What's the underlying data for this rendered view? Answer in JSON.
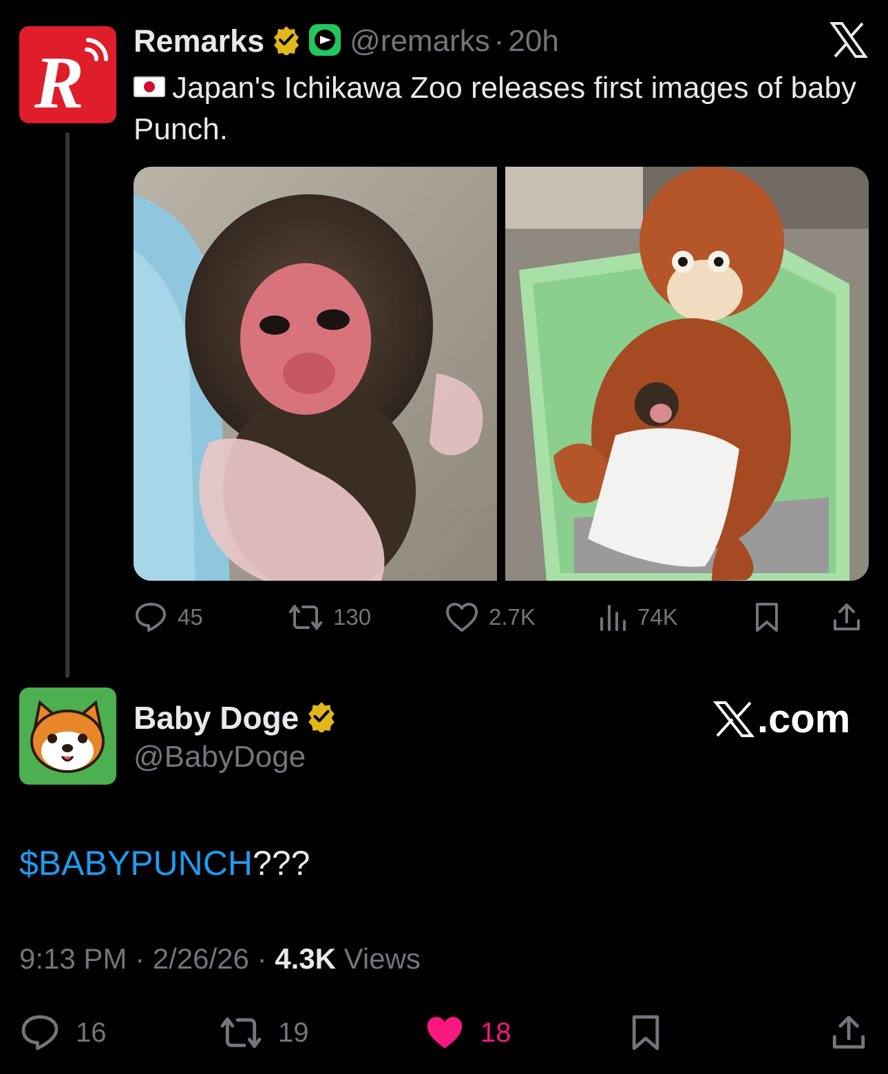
{
  "parent_tweet": {
    "author_name": "Remarks",
    "handle": "@remarks",
    "separator": "·",
    "time": "20h",
    "flag_icon": "japan-flag",
    "text": "Japan's Ichikawa Zoo releases first images of baby Punch.",
    "stats": {
      "replies": "45",
      "reposts": "130",
      "likes": "2.7K",
      "views": "74K"
    }
  },
  "reply_tweet": {
    "author_name": "Baby Doge",
    "handle": "@BabyDoge",
    "cashtag": "$BABYPUNCH",
    "text_suffix": "???",
    "time": "9:13 PM",
    "date": "2/26/26",
    "views_count": "4.3K",
    "views_label": "Views",
    "separator": "·",
    "stats": {
      "replies": "16",
      "reposts": "19",
      "likes": "18"
    }
  },
  "watermark": {
    "label": ".com"
  },
  "colors": {
    "background": "#000000",
    "text": "#e7e9ea",
    "muted": "#71767b",
    "link": "#1d9bf0",
    "like": "#f91880",
    "verified_gold": "#e2b719",
    "remarks_red": "#e01e2b",
    "doge_green": "#4caf50"
  }
}
